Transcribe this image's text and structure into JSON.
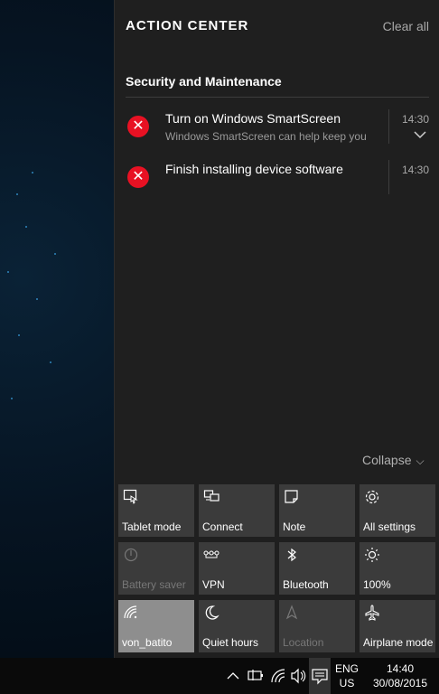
{
  "action_center": {
    "title": "ACTION CENTER",
    "clear_all": "Clear all",
    "group": {
      "title": "Security and Maintenance",
      "notifications": [
        {
          "title": "Turn on Windows SmartScreen",
          "body": "Windows SmartScreen can help keep you",
          "time": "14:30",
          "icon": "error-icon"
        },
        {
          "title": "Finish installing device software",
          "body": "",
          "time": "14:30",
          "icon": "error-icon"
        }
      ]
    },
    "collapse": "Collapse"
  },
  "quick_actions": [
    {
      "label": "Tablet mode",
      "icon": "tablet-mode-icon",
      "state": "normal"
    },
    {
      "label": "Connect",
      "icon": "connect-icon",
      "state": "normal"
    },
    {
      "label": "Note",
      "icon": "note-icon",
      "state": "normal"
    },
    {
      "label": "All settings",
      "icon": "settings-gear-icon",
      "state": "normal"
    },
    {
      "label": "Battery saver",
      "icon": "battery-saver-icon",
      "state": "disabled"
    },
    {
      "label": "VPN",
      "icon": "vpn-icon",
      "state": "normal"
    },
    {
      "label": "Bluetooth",
      "icon": "bluetooth-icon",
      "state": "normal"
    },
    {
      "label": "100%",
      "icon": "brightness-icon",
      "state": "normal"
    },
    {
      "label": "von_batito",
      "icon": "wifi-icon",
      "state": "active"
    },
    {
      "label": "Quiet hours",
      "icon": "moon-icon",
      "state": "normal"
    },
    {
      "label": "Location",
      "icon": "location-icon",
      "state": "disabled"
    },
    {
      "label": "Airplane mode",
      "icon": "airplane-icon",
      "state": "normal"
    }
  ],
  "taskbar": {
    "language_line1": "ENG",
    "language_line2": "US",
    "time": "14:40",
    "date": "30/08/2015"
  },
  "colors": {
    "panel_bg": "#1f1f1f",
    "tile_bg": "#3b3b3b",
    "tile_active_bg": "#8e8e8e",
    "error_red": "#e81123",
    "taskbar_bg": "#0a0a0a"
  }
}
